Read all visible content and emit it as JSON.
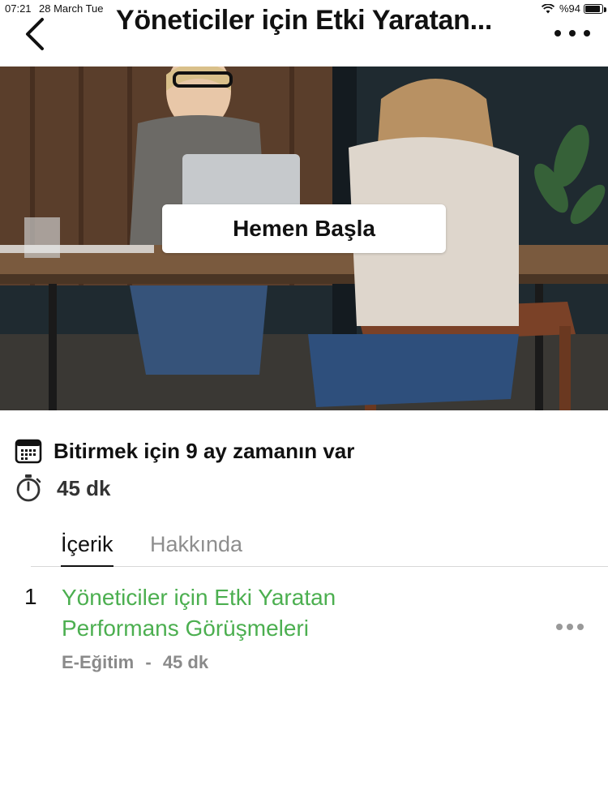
{
  "status_bar": {
    "time": "07:21",
    "date": "28 March Tue",
    "battery": "%94",
    "battery_level": 0.94
  },
  "header": {
    "title": "Yöneticiler için Etki Yaratan...",
    "back_icon": "chevron-left-icon",
    "more_icon": "ellipsis-icon"
  },
  "hero": {
    "start_label": "Hemen Başla"
  },
  "info": {
    "deadline": "Bitirmek için 9 ay zamanın var",
    "deadline_icon": "calendar-icon",
    "duration": "45 dk",
    "duration_icon": "stopwatch-icon"
  },
  "tabs": [
    {
      "label": "İçerik",
      "active": true
    },
    {
      "label": "Hakkında",
      "active": false
    }
  ],
  "content_items": [
    {
      "number": "1",
      "title": "Yöneticiler için Etki Yaratan Performans Görüşmeleri",
      "type": "E-Eğitim",
      "separator": "-",
      "duration": "45 dk"
    }
  ],
  "colors": {
    "accent_green": "#4caf50",
    "inactive_tab": "#8e8e8e",
    "meta_gray": "#8a8a8a"
  }
}
